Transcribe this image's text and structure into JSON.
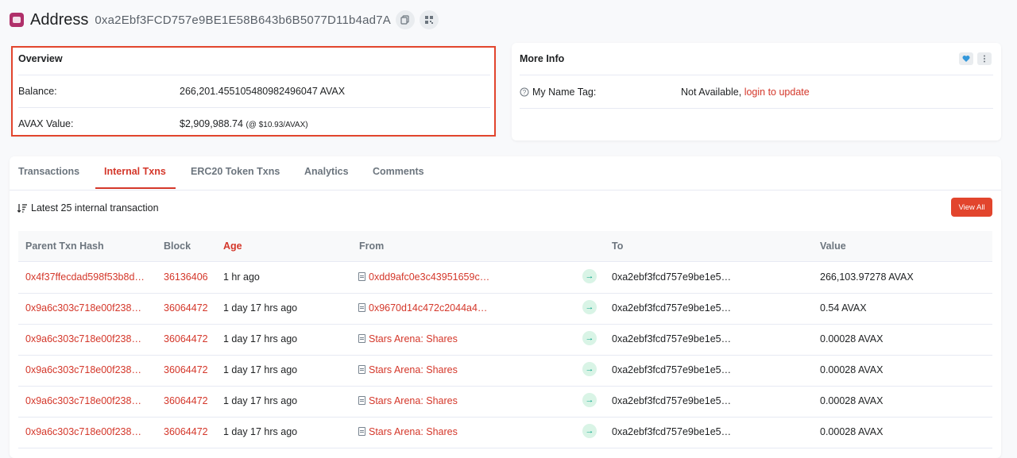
{
  "header": {
    "title": "Address",
    "address": "0xa2Ebf3FCD757e9BE1E58B643b6B5077D11b4ad7A"
  },
  "overview": {
    "title": "Overview",
    "balance_label": "Balance:",
    "balance_value": "266,201.455105480982496047 AVAX",
    "value_label": "AVAX Value:",
    "value_amount": "$2,909,988.74",
    "value_rate": "(@ $10.93/AVAX)"
  },
  "more_info": {
    "title": "More Info",
    "name_tag_label": "My Name Tag:",
    "name_tag_value": "Not Available,",
    "name_tag_link": "login to update"
  },
  "tabs": [
    {
      "label": "Transactions"
    },
    {
      "label": "Internal Txns"
    },
    {
      "label": "ERC20 Token Txns"
    },
    {
      "label": "Analytics"
    },
    {
      "label": "Comments"
    }
  ],
  "list": {
    "title": "Latest 25 internal transaction",
    "view_all": "View All"
  },
  "table": {
    "columns": [
      "Parent Txn Hash",
      "Block",
      "Age",
      "From",
      "To",
      "Value"
    ],
    "rows": [
      {
        "hash": "0x4f37ffecdad598f53b8d…",
        "block": "36136406",
        "age": "1 hr ago",
        "from": "0xdd9afc0e3c43951659c…",
        "to": "0xa2ebf3fcd757e9be1e5…",
        "value": "266,103.97278 AVAX"
      },
      {
        "hash": "0x9a6c303c718e00f238…",
        "block": "36064472",
        "age": "1 day 17 hrs ago",
        "from": "0x9670d14c472c2044a4…",
        "to": "0xa2ebf3fcd757e9be1e5…",
        "value": "0.54 AVAX"
      },
      {
        "hash": "0x9a6c303c718e00f238…",
        "block": "36064472",
        "age": "1 day 17 hrs ago",
        "from": "Stars Arena: Shares",
        "to": "0xa2ebf3fcd757e9be1e5…",
        "value": "0.00028 AVAX"
      },
      {
        "hash": "0x9a6c303c718e00f238…",
        "block": "36064472",
        "age": "1 day 17 hrs ago",
        "from": "Stars Arena: Shares",
        "to": "0xa2ebf3fcd757e9be1e5…",
        "value": "0.00028 AVAX"
      },
      {
        "hash": "0x9a6c303c718e00f238…",
        "block": "36064472",
        "age": "1 day 17 hrs ago",
        "from": "Stars Arena: Shares",
        "to": "0xa2ebf3fcd757e9be1e5…",
        "value": "0.00028 AVAX"
      },
      {
        "hash": "0x9a6c303c718e00f238…",
        "block": "36064472",
        "age": "1 day 17 hrs ago",
        "from": "Stars Arena: Shares",
        "to": "0xa2ebf3fcd757e9be1e5…",
        "value": "0.00028 AVAX"
      }
    ]
  },
  "icons": {
    "copy": "copy-icon",
    "qr": "qr-code-icon",
    "heart": "heart-icon",
    "more": "more-vertical-icon",
    "help": "help-circle-icon",
    "sort": "sort-icon",
    "contract": "contract-icon",
    "arrow": "arrow-right-icon"
  },
  "colors": {
    "accent": "#d4372a",
    "highlight_border": "#e2452d",
    "arrow_bg": "#d9f4e6",
    "arrow_fg": "#00a186"
  }
}
